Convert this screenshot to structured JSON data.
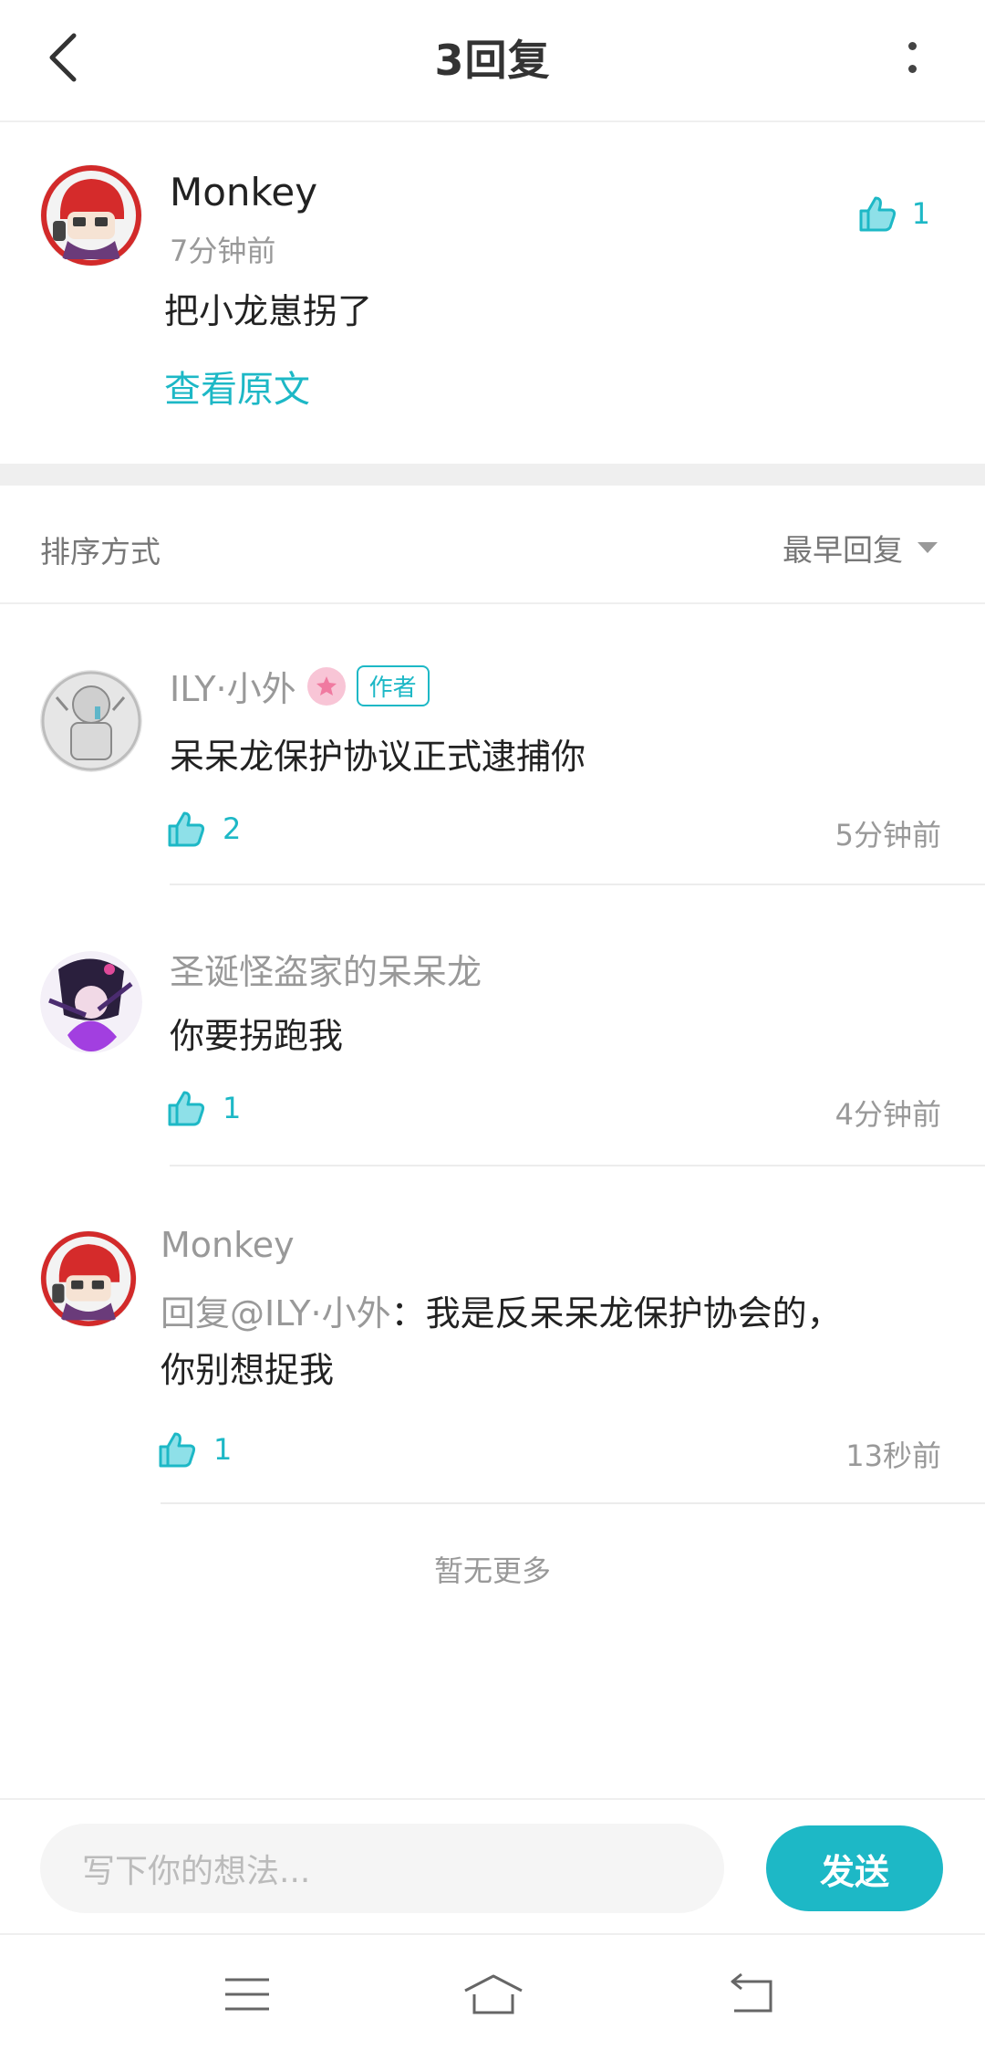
{
  "header": {
    "title": "3回复",
    "back_icon": "chevron-left-icon",
    "more_icon": "more-vertical-icon"
  },
  "main_comment": {
    "author": "Monkey",
    "time": "7分钟前",
    "text": "把小龙崽拐了",
    "view_original": "查看原文",
    "likes": "1"
  },
  "sort": {
    "label": "排序方式",
    "value": "最早回复"
  },
  "replies": [
    {
      "author": "ILY·小外",
      "badge": "作者",
      "text": "呆呆龙保护协议正式逮捕你",
      "likes": "2",
      "time": "5分钟前"
    },
    {
      "author": "圣诞怪盗家的呆呆龙",
      "text": "你要拐跑我",
      "likes": "1",
      "time": "4分钟前"
    },
    {
      "author": "Monkey",
      "mention": "回复@ILY·小外",
      "text_rest": "：我是反呆呆龙保护协会的，",
      "text_line2": "你别想捉我",
      "likes": "1",
      "time": "13秒前"
    }
  ],
  "footer_note": "暂无更多",
  "composer": {
    "placeholder": "写下你的想法...",
    "send_label": "发送"
  },
  "colors": {
    "accent": "#1db8c6",
    "muted_text": "#999999",
    "divider": "#efefef"
  }
}
